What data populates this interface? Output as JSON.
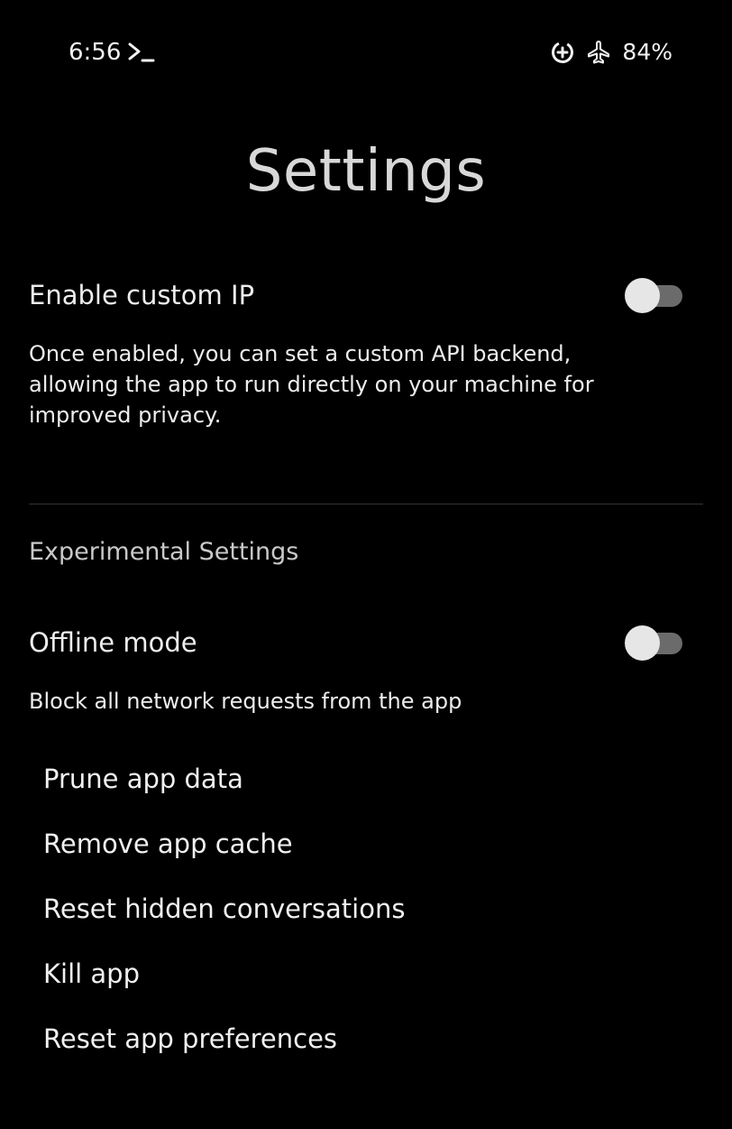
{
  "status_bar": {
    "time": "6:56",
    "terminal_icon": "terminal-prompt-icon",
    "data_saver_icon": "data-saver-icon",
    "airplane_icon": "airplane-mode-icon",
    "battery": "84%"
  },
  "page": {
    "title": "Settings"
  },
  "custom_ip": {
    "title": "Enable custom IP",
    "description": "Once enabled, you can set a custom API backend, allowing the app to run directly on your machine for improved privacy.",
    "enabled": false
  },
  "experimental": {
    "header": "Experimental Settings",
    "offline_mode": {
      "title": "Offline mode",
      "description": "Block all network requests from the app",
      "enabled": false
    },
    "actions": [
      "Prune app data",
      "Remove app cache",
      "Reset hidden conversations",
      "Kill app",
      "Reset app preferences"
    ]
  },
  "colors": {
    "background": "#000000",
    "text": "#ededed",
    "toggle_track_off": "#6b6b6b",
    "toggle_thumb_off": "#e6e6e6"
  }
}
